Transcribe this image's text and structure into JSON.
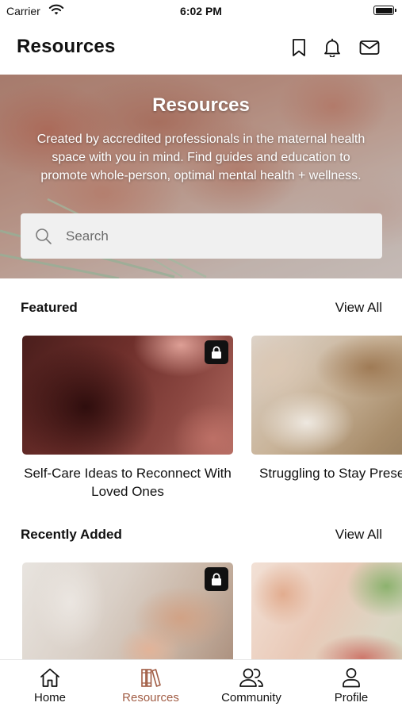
{
  "status_bar": {
    "carrier": "Carrier",
    "time": "6:02 PM"
  },
  "header": {
    "title": "Resources",
    "icons": [
      "bookmark-icon",
      "bell-icon",
      "envelope-icon"
    ]
  },
  "hero": {
    "title": "Resources",
    "description": "Created by accredited professionals in the maternal health space with you in mind. Find guides and education to promote whole-person, optimal mental health + wellness.",
    "search_placeholder": "Search"
  },
  "featured": {
    "title": "Featured",
    "view_all": "View All",
    "cards": [
      {
        "title": "Self-Care Ideas to Reconnect With Loved Ones",
        "locked": true
      },
      {
        "title": "Struggling to Stay Present? Journal Prompts",
        "locked": false
      }
    ]
  },
  "recently_added": {
    "title": "Recently Added",
    "view_all": "View All",
    "cards": [
      {
        "title": "",
        "locked": true
      },
      {
        "title": "",
        "locked": false
      }
    ]
  },
  "tab_bar": {
    "active": "Resources",
    "accent_color": "#a15d45",
    "tabs": [
      {
        "label": "Home",
        "icon": "home-icon"
      },
      {
        "label": "Resources",
        "icon": "books-icon"
      },
      {
        "label": "Community",
        "icon": "people-icon"
      },
      {
        "label": "Profile",
        "icon": "person-icon"
      }
    ]
  }
}
